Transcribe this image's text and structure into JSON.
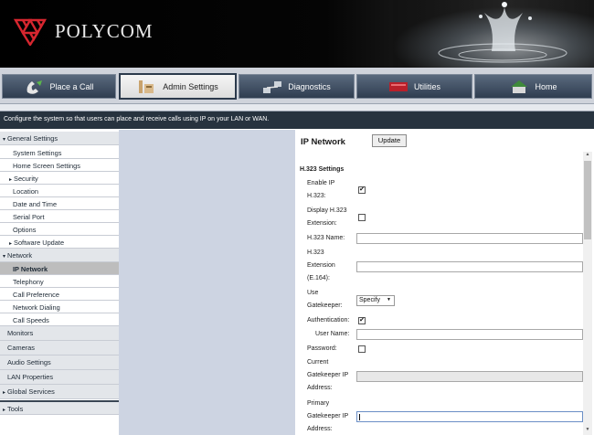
{
  "header": {
    "brand": "POLYCOM"
  },
  "nav": {
    "items": [
      {
        "label": "Place a Call"
      },
      {
        "label": "Admin Settings"
      },
      {
        "label": "Diagnostics"
      },
      {
        "label": "Utilities"
      },
      {
        "label": "Home"
      }
    ]
  },
  "description": "Configure the system so that users can place and receive calls using IP on your LAN or WAN.",
  "sidebar": {
    "items": [
      {
        "label": "General Settings"
      },
      {
        "label": "System Settings"
      },
      {
        "label": "Home Screen Settings"
      },
      {
        "label": "Security"
      },
      {
        "label": "Location"
      },
      {
        "label": "Date and Time"
      },
      {
        "label": "Serial Port"
      },
      {
        "label": "Options"
      },
      {
        "label": "Software Update"
      },
      {
        "label": "Network"
      },
      {
        "label": "IP Network"
      },
      {
        "label": "Telephony"
      },
      {
        "label": "Call Preference"
      },
      {
        "label": "Network Dialing"
      },
      {
        "label": "Call Speeds"
      },
      {
        "label": "Monitors"
      },
      {
        "label": "Cameras"
      },
      {
        "label": "Audio Settings"
      },
      {
        "label": "LAN Properties"
      },
      {
        "label": "Global Services"
      },
      {
        "label": "Tools"
      }
    ]
  },
  "form": {
    "title": "IP Network",
    "update_label": "Update",
    "section": "H.323 Settings",
    "enable_ip_h323_l1": "Enable IP",
    "enable_ip_h323_l2": "H.323:",
    "display_ext_l1": "Display H.323",
    "display_ext_l2": "Extension:",
    "h323_name": "H.323 Name:",
    "h323_ext_l1": "H.323",
    "h323_ext_l2": "Extension",
    "h323_ext_l3": "(E.164):",
    "use_gk_l1": "Use",
    "use_gk_l2": "Gatekeeper:",
    "gatekeeper_mode": "Specify",
    "authentication": "Authentication:",
    "user_name": "User Name:",
    "password": "Password:",
    "current_gk_l1": "Current",
    "current_gk_l2": "Gatekeeper IP",
    "current_gk_l3": "Address:",
    "primary_gk_l1": "Primary",
    "primary_gk_l2": "Gatekeeper IP",
    "primary_gk_l3": "Address:",
    "check_mark": "✔"
  },
  "icons": {
    "up": "▲",
    "down": "▼",
    "tri_down": "▾",
    "tri_right": "▸"
  }
}
